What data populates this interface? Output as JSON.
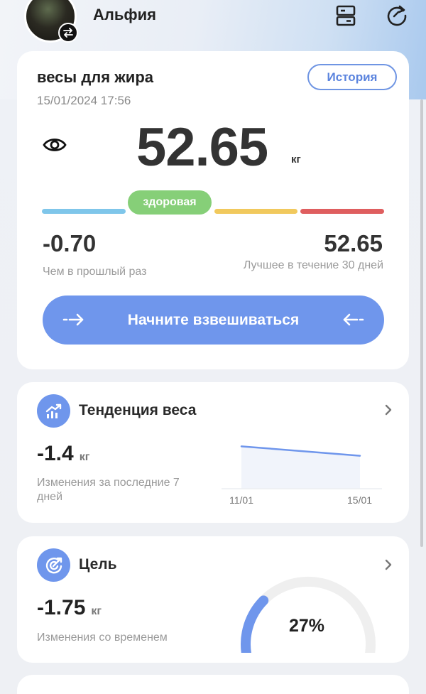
{
  "header": {
    "user_name": "Альфия",
    "icons": [
      "user-swap-icon",
      "devices-icon",
      "sync-icon"
    ]
  },
  "scale_card": {
    "title": "весы для жира",
    "datetime": "15/01/2024 17:56",
    "history_label": "История",
    "weight": "52.65",
    "unit": "кг",
    "status_label": "здоровая",
    "change_value": "-0.70",
    "change_label": "Чем в прошлый раз",
    "best_value": "52.65",
    "best_label": "Лучшее в течение 30 дней",
    "start_label": "Начните взвешиваться",
    "range_colors": [
      "#7fc6ea",
      "#86cf78",
      "#f1c95d",
      "#df5e5f"
    ],
    "accent": "#6f96ec"
  },
  "trend_card": {
    "title": "Тенденция веса",
    "delta": "-1.4",
    "unit": "кг",
    "label": "Изменения за последние 7 дней",
    "chart_data": {
      "type": "area",
      "x": [
        "11/01",
        "15/01"
      ],
      "values": [
        54.05,
        52.65
      ]
    }
  },
  "goal_card": {
    "title": "Цель",
    "delta": "-1.75",
    "unit": "кг",
    "label": "Изменения со временем",
    "progress_text": "27%",
    "progress": 0.27
  }
}
